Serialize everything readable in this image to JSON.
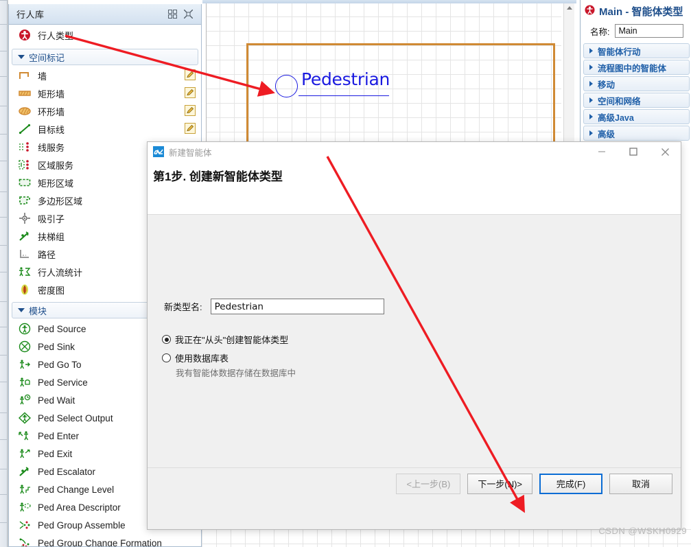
{
  "colors": {
    "accent_blue": "#1f4f8b",
    "annotation_red": "#ee1c23",
    "wall_orange": "#d08a34",
    "agent_blue": "#1a1ae0",
    "module_green": "#1a8a1a",
    "default_button_border": "#0a6cd4"
  },
  "palette": {
    "title": "行人库",
    "header_icons": [
      {
        "name": "grid-view-icon",
        "glyph": "grid"
      },
      {
        "name": "collapse-all-icon",
        "glyph": "collapse"
      }
    ],
    "top_item": {
      "label": "行人类型",
      "icon": "pedestrian-type-icon"
    },
    "groups": [
      {
        "label": "空间标记",
        "expanded": true,
        "items": [
          {
            "label": "墙",
            "icon": "wall-icon",
            "editable": true
          },
          {
            "label": "矩形墙",
            "icon": "rectangular-wall-icon",
            "editable": true
          },
          {
            "label": "环形墙",
            "icon": "circular-wall-icon",
            "editable": true
          },
          {
            "label": "目标线",
            "icon": "target-line-icon",
            "editable": true
          },
          {
            "label": "线服务",
            "icon": "line-service-icon",
            "editable": false
          },
          {
            "label": "区域服务",
            "icon": "area-service-icon",
            "editable": false
          },
          {
            "label": "矩形区域",
            "icon": "rectangular-area-icon",
            "editable": false
          },
          {
            "label": "多边形区域",
            "icon": "polygonal-area-icon",
            "editable": false
          },
          {
            "label": "吸引子",
            "icon": "attractor-icon",
            "editable": false
          },
          {
            "label": "扶梯组",
            "icon": "escalator-group-icon",
            "editable": false
          },
          {
            "label": "路径",
            "icon": "pathway-icon",
            "editable": false
          },
          {
            "label": "行人流统计",
            "icon": "ped-flow-statistics-icon",
            "editable": false
          },
          {
            "label": "密度图",
            "icon": "density-map-icon",
            "editable": false
          }
        ]
      },
      {
        "label": "模块",
        "expanded": true,
        "items": [
          {
            "label": "Ped Source",
            "icon": "ped-source-icon",
            "editable": false
          },
          {
            "label": "Ped Sink",
            "icon": "ped-sink-icon",
            "editable": false
          },
          {
            "label": "Ped Go To",
            "icon": "ped-go-to-icon",
            "editable": false
          },
          {
            "label": "Ped Service",
            "icon": "ped-service-icon",
            "editable": false
          },
          {
            "label": "Ped Wait",
            "icon": "ped-wait-icon",
            "editable": false
          },
          {
            "label": "Ped Select Output",
            "icon": "ped-select-output-icon",
            "editable": false
          },
          {
            "label": "Ped Enter",
            "icon": "ped-enter-icon",
            "editable": false
          },
          {
            "label": "Ped Exit",
            "icon": "ped-exit-icon",
            "editable": false
          },
          {
            "label": "Ped Escalator",
            "icon": "ped-escalator-icon",
            "editable": false
          },
          {
            "label": "Ped Change Level",
            "icon": "ped-change-level-icon",
            "editable": false
          },
          {
            "label": "Ped Area Descriptor",
            "icon": "ped-area-descriptor-icon",
            "editable": false
          },
          {
            "label": "Ped Group Assemble",
            "icon": "ped-group-assemble-icon",
            "editable": false
          },
          {
            "label": "Ped Group Change Formation",
            "icon": "ped-group-change-formation-icon",
            "editable": false
          }
        ]
      }
    ]
  },
  "canvas": {
    "agent_label": "Pedestrian"
  },
  "properties": {
    "title": "Main - 智能体类型",
    "name_label": "名称:",
    "name_value": "Main",
    "sections": [
      {
        "label": "智能体行动"
      },
      {
        "label": "流程图中的智能体"
      },
      {
        "label": "移动"
      },
      {
        "label": "空间和网络"
      },
      {
        "label": "高级Java"
      },
      {
        "label": "高级"
      }
    ]
  },
  "dialog": {
    "window_title": "新建智能体",
    "step_heading": "第1步. 创建新智能体类型",
    "field_label": "新类型名:",
    "field_value": "Pedestrian",
    "options": [
      {
        "label": "我正在\"从头\"创建智能体类型",
        "selected": true,
        "sublabel": ""
      },
      {
        "label": "使用数据库表",
        "selected": false,
        "sublabel": "我有智能体数据存储在数据库中"
      }
    ],
    "window_buttons": [
      {
        "name": "minimize-button",
        "glyph": "—"
      },
      {
        "name": "maximize-button",
        "glyph": "□"
      },
      {
        "name": "close-button",
        "glyph": "✕"
      }
    ],
    "buttons": [
      {
        "name": "back-button",
        "label": "<上一步(B)",
        "state": "disabled"
      },
      {
        "name": "next-button",
        "label": "下一步(N)>",
        "state": "normal"
      },
      {
        "name": "finish-button",
        "label": "完成(F)",
        "state": "default"
      },
      {
        "name": "cancel-button",
        "label": "取消",
        "state": "normal"
      }
    ]
  },
  "watermark": "CSDN @WSKH0929"
}
